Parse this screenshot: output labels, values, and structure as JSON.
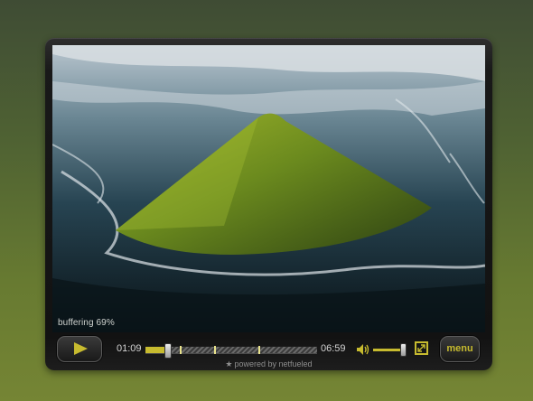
{
  "player": {
    "buffering_label": "buffering 69%",
    "buffering_percent": 69,
    "time_current": "01:09",
    "time_total": "06:59",
    "played_fraction": 0.11,
    "chapter_marks_fraction": [
      0.2,
      0.4,
      0.66
    ],
    "volume_fraction": 0.92,
    "menu_label": "menu",
    "powered_by": "powered by netfueled",
    "accent_color": "#c7bb2f",
    "icons": {
      "play": "play-icon",
      "volume": "speaker-icon",
      "fullscreen": "fullscreen-icon",
      "powered": "star-icon"
    }
  }
}
